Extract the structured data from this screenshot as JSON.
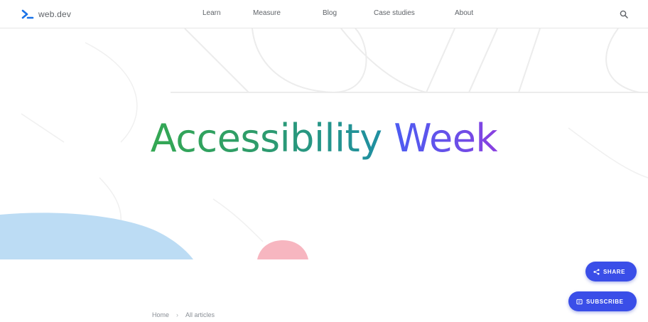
{
  "header": {
    "brand": "web.dev",
    "nav": [
      {
        "label": "Learn"
      },
      {
        "label": "Measure"
      },
      {
        "label": "Blog"
      },
      {
        "label": "Case studies"
      },
      {
        "label": "About"
      }
    ],
    "search_icon": "search-icon"
  },
  "hero": {
    "title_word1": "Accessibility",
    "title_word2": "Week"
  },
  "actions": {
    "share_label": "SHARE",
    "subscribe_label": "SUBSCRIBE"
  },
  "breadcrumb": {
    "items": [
      "Home",
      "All articles"
    ],
    "separator": "›"
  },
  "colors": {
    "accent": "#3a4ee8",
    "title_green": "#34a853",
    "title_purple": "#6a4fe8"
  }
}
